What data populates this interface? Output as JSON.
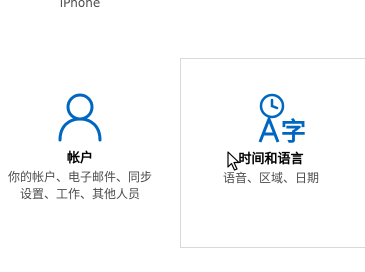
{
  "previous_tile": {
    "label": "iPhone"
  },
  "accounts": {
    "title": "帐户",
    "desc_lines": [
      "你的帐户、电子邮件、同步",
      "设置、工作、其他人员"
    ],
    "icon": "person-icon"
  },
  "time_language": {
    "title": "时间和语言",
    "desc_lines": [
      "语音、区域、日期"
    ],
    "icon": "time-language-icon"
  },
  "colors": {
    "accent": "#0067c0",
    "text": "#000000",
    "subtext": "#4c4c4c",
    "tile_border": "#d9d9d9"
  }
}
